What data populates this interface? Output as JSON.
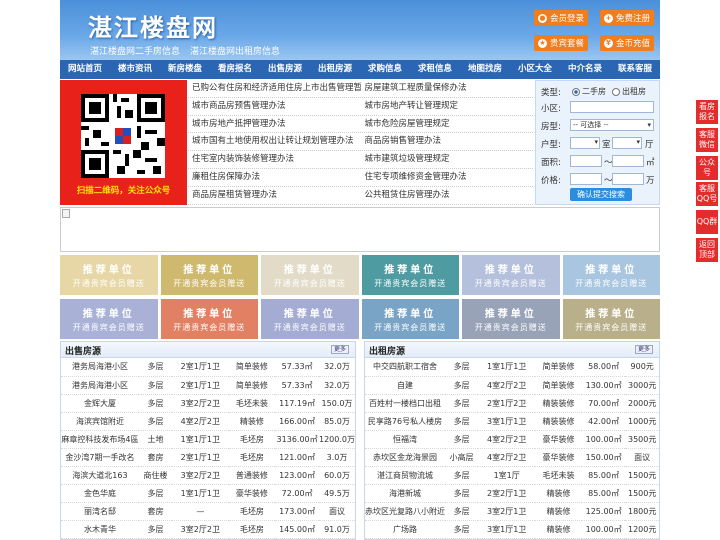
{
  "header": {
    "logo": "湛江楼盘网",
    "sub_links": [
      "湛江楼盘网二手房信息",
      "湛江楼盘网出租房信息"
    ],
    "buttons": [
      {
        "label": "会员登录",
        "icon": "user-icon"
      },
      {
        "label": "免费注册",
        "icon": "register-icon"
      },
      {
        "label": "贵宾套餐",
        "icon": "vip-icon"
      },
      {
        "label": "金币充值",
        "icon": "coin-icon"
      }
    ]
  },
  "nav": [
    "网站首页",
    "楼市资讯",
    "新房楼盘",
    "看房报名",
    "出售房源",
    "出租房源",
    "求购信息",
    "求租信息",
    "地图找房",
    "小区大全",
    "中介名录",
    "联系客服"
  ],
  "qr": {
    "caption": "扫描二维码，关注公众号"
  },
  "links": [
    [
      "已购公有住房和经济适用住房上市出售管理暂",
      "房屋建筑工程质量保修办法"
    ],
    [
      "城市商品房预售管理办法",
      "城市房地产转让管理规定"
    ],
    [
      "城市房地产抵押管理办法",
      "城市危险房屋管理规定"
    ],
    [
      "城市国有土地使用权出让转让规划管理办法",
      "商品房销售管理办法"
    ],
    [
      "住宅室内装饰装修管理办法",
      "城市建筑垃圾管理规定"
    ],
    [
      "廉租住房保障办法",
      "住宅专项维修资金管理办法"
    ],
    [
      "商品房屋租赁管理办法",
      "公共租赁住房管理办法"
    ]
  ],
  "search": {
    "type_label": "类型:",
    "opt1": "二手房",
    "opt2": "出租房",
    "area_label": "小区:",
    "house_label": "房型:",
    "house_select": "-- 可选择 --",
    "layout_label": "户型:",
    "room": "室",
    "hall": "厅",
    "size_label": "面积:",
    "size_unit": "㎡",
    "price_label": "价格:",
    "price_unit": "万",
    "submit": "确认提交搜索"
  },
  "promo": {
    "title": "推荐单位",
    "subtitle": "开通贵宾会员赠送",
    "colors": [
      "#e7d7a6",
      "#cfb96e",
      "#e2dbc8",
      "#4e9ca1",
      "#b5c0dc",
      "#a8c6e0",
      "#a9b2d6",
      "#e28063",
      "#a4acd4",
      "#7aa4c6",
      "#98a3b8",
      "#b9b08b"
    ]
  },
  "sale": {
    "title": "出售房源",
    "more": "更多",
    "rows": [
      [
        "港务局海港小区",
        "多层",
        "2室1厅1卫",
        "简单装修",
        "57.33㎡",
        "32.0万"
      ],
      [
        "港务局海港小区",
        "多层",
        "2室1厅1卫",
        "简单装修",
        "57.33㎡",
        "32.0万"
      ],
      [
        "金辉大厦",
        "多层",
        "3室2厅2卫",
        "毛坯未装",
        "117.19㎡",
        "150.0万"
      ],
      [
        "海滨宾馆附近",
        "多层",
        "4室2厅2卫",
        "精装修",
        "166.00㎡",
        "85.0万"
      ],
      [
        "麻章控科技发布场4區",
        "土地",
        "1室1厅1卫",
        "毛坯房",
        "3136.00㎡",
        "1200.0万"
      ],
      [
        "金沙湾7期一手改名",
        "套房",
        "2室1厅1卫",
        "毛坯房",
        "121.00㎡",
        "3.0万"
      ],
      [
        "海滨大道北163",
        "商住楼",
        "3室2厅2卫",
        "普通装修",
        "123.00㎡",
        "60.0万"
      ],
      [
        "金色华庭",
        "多层",
        "1室1厅1卫",
        "豪华装修",
        "72.00㎡",
        "49.5万"
      ],
      [
        "丽湾名邸",
        "套房",
        "—",
        "毛坯房",
        "173.00㎡",
        "面议"
      ],
      [
        "水木青华",
        "多层",
        "3室2厅2卫",
        "毛坯房",
        "145.00㎡",
        "91.0万"
      ]
    ]
  },
  "rent": {
    "title": "出租房源",
    "more": "更多",
    "rows": [
      [
        "中交四航职工宿舍",
        "多层",
        "1室1厅1卫",
        "简单装修",
        "58.00㎡",
        "900元"
      ],
      [
        "自建",
        "多层",
        "4室2厅2卫",
        "简单装修",
        "130.00㎡",
        "3000元"
      ],
      [
        "百姓村一楼档口出租",
        "多层",
        "2室1厅2卫",
        "精装装修",
        "70.00㎡",
        "2000元"
      ],
      [
        "民享路76号私人楼房",
        "多层",
        "3室1厅1卫",
        "精装装修",
        "42.00㎡",
        "1000元"
      ],
      [
        "恒福湾",
        "多层",
        "4室2厅2卫",
        "豪华装修",
        "100.00㎡",
        "3500元"
      ],
      [
        "赤坎区金龙海景园",
        "小高层",
        "4室2厅2卫",
        "豪华装修",
        "150.00㎡",
        "面议"
      ],
      [
        "湛江商贸物流城",
        "多层",
        "1室1厅",
        "毛坯未装",
        "85.00㎡",
        "1500元"
      ],
      [
        "海港新城",
        "多层",
        "2室2厅1卫",
        "精装修",
        "85.00㎡",
        "1500元"
      ],
      [
        "赤坎区光复路八小附近",
        "多层",
        "3室2厅1卫",
        "精装修",
        "125.00㎡",
        "1800元"
      ],
      [
        "广场路",
        "多层",
        "3室1厅1卫",
        "精装修",
        "100.00㎡",
        "1200元"
      ]
    ]
  },
  "side": [
    "看房报名",
    "客服微信",
    "公众号",
    "客服QQ号",
    "QQ群",
    "返回顶部"
  ]
}
